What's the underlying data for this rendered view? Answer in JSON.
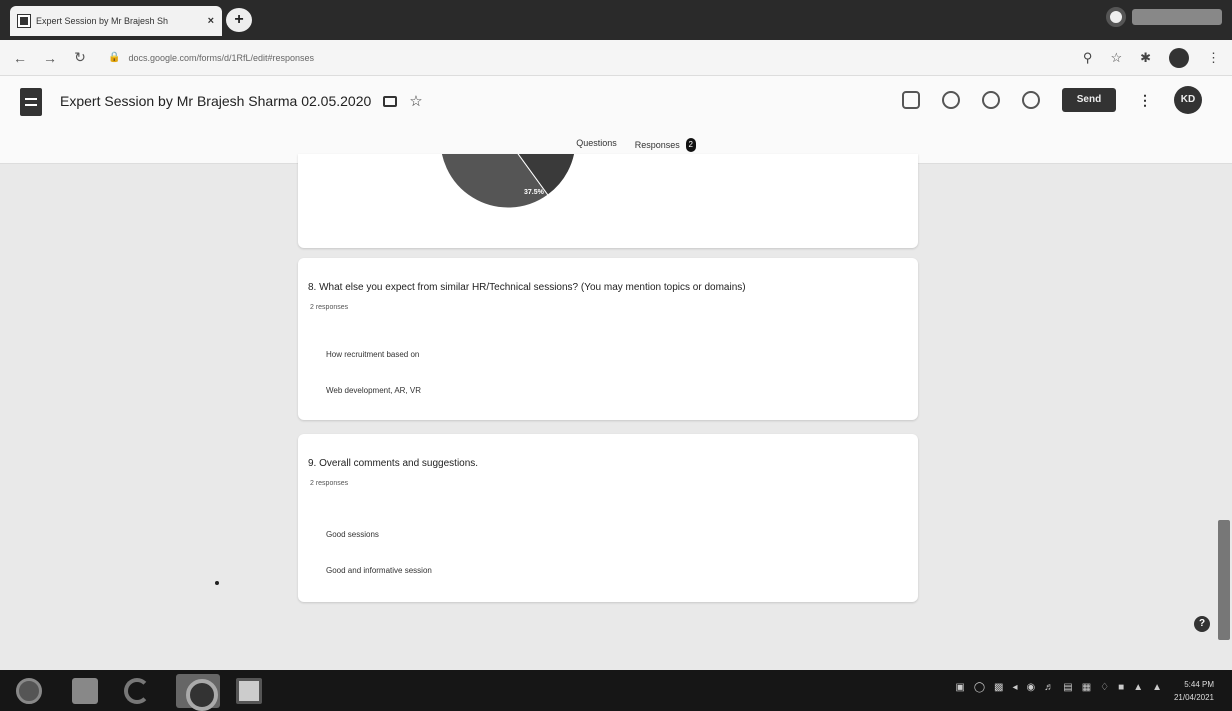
{
  "browser": {
    "tab_title": "Expert Session by Mr Brajesh Sh",
    "tab_close": "×",
    "new_tab": "+",
    "url": "docs.google.com/forms/d/1RfL/edit#responses"
  },
  "form": {
    "title": "Expert Session by Mr Brajesh Sharma 02.05.2020",
    "send_label": "Send",
    "avatar_initials": "KD",
    "tabs": {
      "questions": "Questions",
      "responses": "Responses",
      "responses_count": "2"
    }
  },
  "chart_data": {
    "type": "pie",
    "slice_label": "37.5%",
    "values": [
      37.5,
      62.5
    ]
  },
  "questions": [
    {
      "title": "8. What else you expect from similar HR/Technical sessions? (You may mention topics or domains)",
      "count": "2 responses",
      "responses": [
        "How recruitment based on",
        "Web development, AR, VR"
      ]
    },
    {
      "title": "9. Overall comments and suggestions.",
      "count": "2 responses",
      "responses": [
        "Good sessions",
        "Good and informative session"
      ]
    }
  ],
  "taskbar": {
    "time": "5:44 PM",
    "date": "21/04/2021"
  },
  "help": "?"
}
